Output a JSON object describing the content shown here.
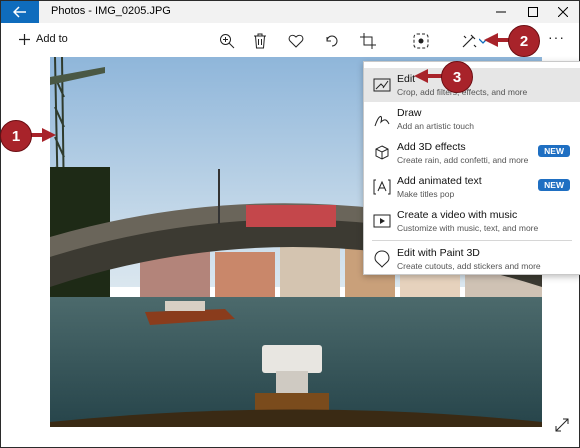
{
  "window": {
    "title": "Photos - IMG_0205.JPG"
  },
  "toolbar": {
    "add_to_label": "Add to",
    "icons": [
      "zoom-icon",
      "delete-icon",
      "favorite-icon",
      "rotate-icon",
      "crop-icon",
      "enhance-icon",
      "edit-create-icon",
      "chevron-down-icon"
    ],
    "more_label": "···"
  },
  "menu": {
    "items": [
      {
        "title": "Edit",
        "subtitle": "Crop, add filters, effects, and more",
        "icon": "edit-photo-icon",
        "active": true
      },
      {
        "title": "Draw",
        "subtitle": "Add an artistic touch",
        "icon": "draw-icon"
      },
      {
        "title": "Add 3D effects",
        "subtitle": "Create rain, add confetti, and more",
        "icon": "3d-effects-icon",
        "badge": "NEW"
      },
      {
        "title": "Add animated text",
        "subtitle": "Make titles pop",
        "icon": "animated-text-icon",
        "badge": "NEW"
      },
      {
        "title": "Create a video with music",
        "subtitle": "Customize with music, text, and more",
        "icon": "video-icon"
      },
      {
        "title": "Edit with Paint 3D",
        "subtitle": "Create cutouts, add stickers and more",
        "icon": "paint3d-icon"
      }
    ]
  },
  "callouts": {
    "one": "1",
    "two": "2",
    "three": "3"
  },
  "colors": {
    "accent": "#0f6cbd",
    "badge": "#1f6fc2",
    "callout": "#a8232a"
  }
}
